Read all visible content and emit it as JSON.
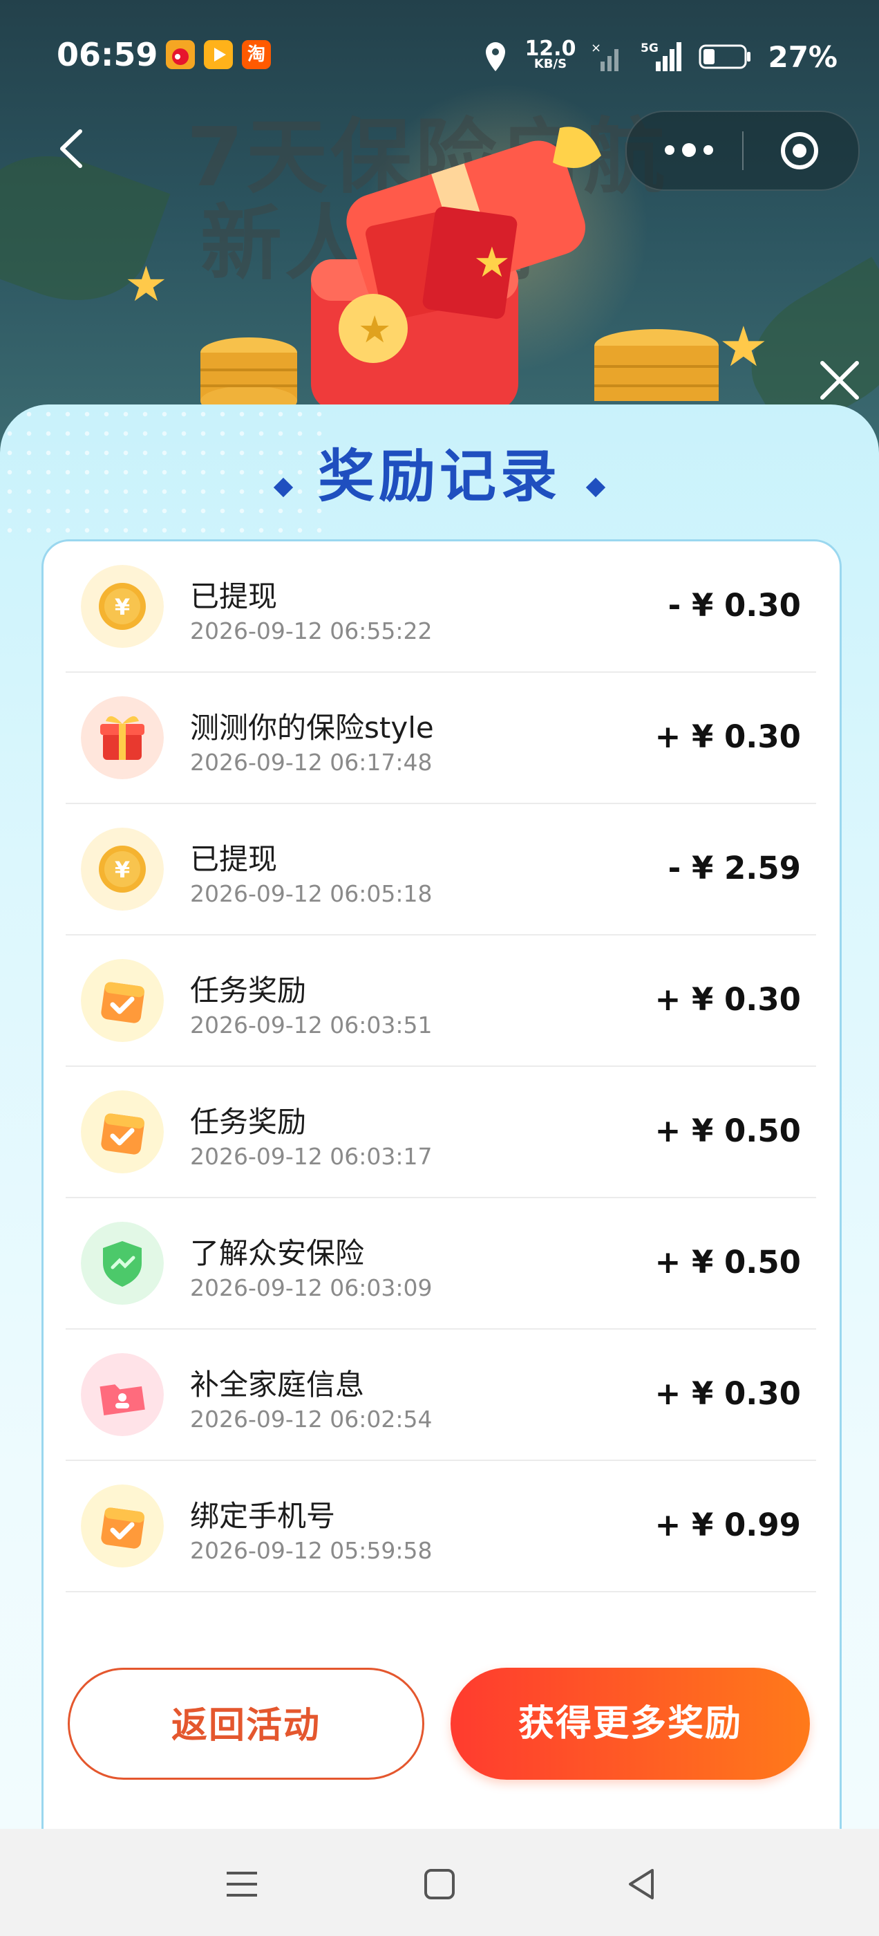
{
  "status_bar": {
    "time": "06:59",
    "apps": [
      {
        "icon": "weibo-icon",
        "color": "#f5a623"
      },
      {
        "icon": "video-app-icon",
        "color": "#ffb21a"
      },
      {
        "icon": "taobao-icon",
        "label": "淘",
        "color": "#ff5a00"
      }
    ],
    "net_speed_value": "12.0",
    "net_speed_unit": "KB/S",
    "network": "5G",
    "battery_percent": "27%"
  },
  "banner": {
    "line1": "7天保险启航",
    "line2": "新人福利"
  },
  "panel": {
    "title": "奖励记录"
  },
  "records": [
    {
      "title": "已提现",
      "time": "2026-09-12 06:55:22",
      "amount": "- ¥ 0.30",
      "icon": "yuan-coin-icon"
    },
    {
      "title": "测测你的保险style",
      "time": "2026-09-12 06:17:48",
      "amount": "+ ¥ 0.30",
      "icon": "gift-box-icon"
    },
    {
      "title": "已提现",
      "time": "2026-09-12 06:05:18",
      "amount": "- ¥ 2.59",
      "icon": "yuan-coin-icon"
    },
    {
      "title": "任务奖励",
      "time": "2026-09-12 06:03:51",
      "amount": "+ ¥ 0.30",
      "icon": "calendar-check-icon"
    },
    {
      "title": "任务奖励",
      "time": "2026-09-12 06:03:17",
      "amount": "+ ¥ 0.50",
      "icon": "calendar-check-icon"
    },
    {
      "title": "了解众安保险",
      "time": "2026-09-12 06:03:09",
      "amount": "+ ¥ 0.50",
      "icon": "shield-icon"
    },
    {
      "title": "补全家庭信息",
      "time": "2026-09-12 06:02:54",
      "amount": "+ ¥ 0.30",
      "icon": "folder-user-icon"
    },
    {
      "title": "绑定手机号",
      "time": "2026-09-12 05:59:58",
      "amount": "+ ¥ 0.99",
      "icon": "calendar-check-icon"
    }
  ],
  "buttons": {
    "back_label": "返回活动",
    "more_label": "获得更多奖励"
  },
  "colors": {
    "accent": "#ff5a22",
    "title_blue": "#1f4fbf",
    "panel_top": "#c9f2fb"
  }
}
